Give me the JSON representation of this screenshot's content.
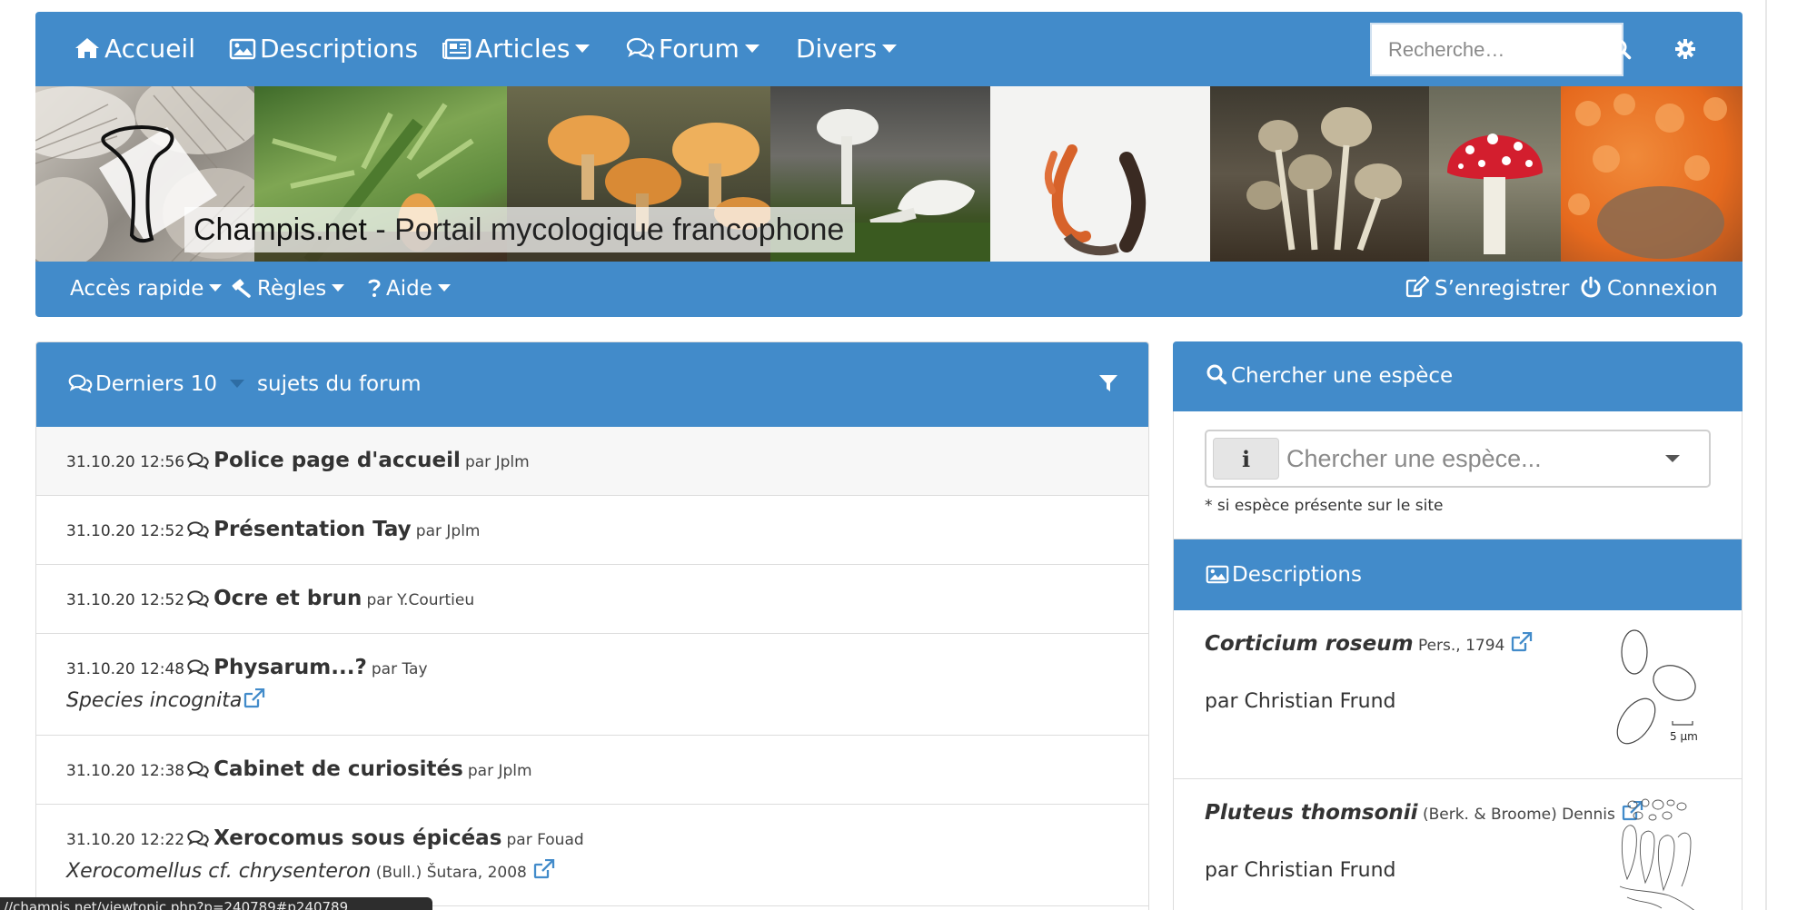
{
  "nav": {
    "home": "Accueil",
    "descriptions": "Descriptions",
    "articles": "Articles",
    "forum": "Forum",
    "misc": "Divers",
    "search_placeholder": "Recherche…"
  },
  "banner": {
    "site_name": "Champis.net",
    "tagline": " - Portail mycologique francophone"
  },
  "subnav": {
    "quick_access": "Accès rapide",
    "rules": "Règles",
    "help": "Aide",
    "register": "S’enregistrer",
    "login": "Connexion"
  },
  "forum": {
    "header_prefix": "Derniers 10",
    "header_suffix": "sujets du forum",
    "topics": [
      {
        "time": "31.10.20 12:56",
        "title": "Police page d'accueil",
        "by": "par Jplm"
      },
      {
        "time": "31.10.20 12:52",
        "title": "Présentation Tay",
        "by": "par Jplm"
      },
      {
        "time": "31.10.20 12:52",
        "title": "Ocre et brun",
        "by": "par Y.Courtieu"
      },
      {
        "time": "31.10.20 12:48",
        "title": "Physarum...?",
        "by": "par Tay",
        "species": "Species incognita",
        "species_author": ""
      },
      {
        "time": "31.10.20 12:38",
        "title": "Cabinet de curiosités",
        "by": "par Jplm"
      },
      {
        "time": "31.10.20 12:22",
        "title": "Xerocomus sous épicéas",
        "by": "par Fouad",
        "species": "Xerocomellus cf. chrysenteron",
        "species_author": " (Bull.) Šutara, 2008"
      }
    ]
  },
  "species_search": {
    "header": "Chercher une espèce",
    "info_label": "i",
    "placeholder": "Chercher une espèce...",
    "note": "* si espèce présente sur le site"
  },
  "descriptions": {
    "header": "Descriptions",
    "scale_label": "5 µm",
    "items": [
      {
        "name": "Corticium roseum",
        "author": " Pers., 1794",
        "by": "par Christian Frund"
      },
      {
        "name": "Pluteus thomsonii",
        "author": " (Berk. & Broome) Dennis",
        "by": "par Christian Frund"
      }
    ]
  },
  "statusbar": {
    "url": "//champis.net/viewtopic.php?p=240789#p240789"
  },
  "colors": {
    "primary": "#428bca",
    "text": "#333333",
    "border": "#dddddd"
  },
  "icons": [
    "home-icon",
    "image-icon",
    "newspaper-icon",
    "comments-icon",
    "search-icon",
    "gear-icon",
    "gavel-icon",
    "question-icon",
    "edit-icon",
    "power-icon",
    "filter-icon",
    "info-icon",
    "external-link-icon"
  ]
}
